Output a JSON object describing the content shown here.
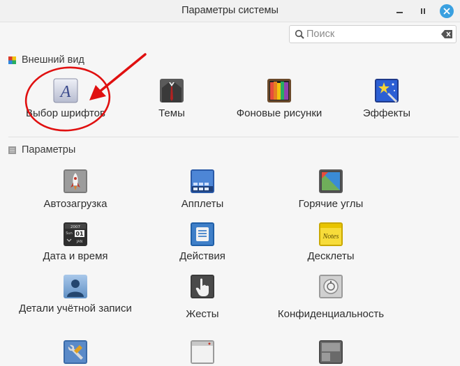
{
  "window": {
    "title": "Параметры системы"
  },
  "search": {
    "placeholder": "Поиск"
  },
  "sections": {
    "appearance": {
      "title": "Внешний вид"
    },
    "preferences": {
      "title": "Параметры"
    }
  },
  "appearance_items": [
    {
      "label": "Выбор шрифтов",
      "icon": "font-icon"
    },
    {
      "label": "Темы",
      "icon": "suit-icon"
    },
    {
      "label": "Фоновые рисунки",
      "icon": "wallpaper-icon"
    },
    {
      "label": "Эффекты",
      "icon": "effects-icon"
    }
  ],
  "preferences_items": [
    {
      "label": "Автозагрузка",
      "icon": "rocket-icon"
    },
    {
      "label": "Апплеты",
      "icon": "applets-icon"
    },
    {
      "label": "Горячие углы",
      "icon": "hot-corner-icon"
    },
    {
      "label": "Дата и время",
      "icon": "calendar-icon"
    },
    {
      "label": "Действия",
      "icon": "actions-icon"
    },
    {
      "label": "Десклеты",
      "icon": "notes-icon"
    },
    {
      "label": "Детали учётной записи",
      "icon": "user-icon"
    },
    {
      "label": "Жесты",
      "icon": "hand-icon"
    },
    {
      "label": "Конфиденциальность",
      "icon": "privacy-icon"
    },
    {
      "label": "",
      "icon": "tools-icon"
    },
    {
      "label": "",
      "icon": "window-icon"
    },
    {
      "label": "",
      "icon": "workspace-icon"
    }
  ],
  "calendar_icon": {
    "year": "2007",
    "day_name": "Sun",
    "day": "01",
    "month": "JAN"
  },
  "notes_icon": {
    "text": "Notes"
  },
  "colors": {
    "accent": "#3aa0e0",
    "annotation": "#e01010"
  }
}
